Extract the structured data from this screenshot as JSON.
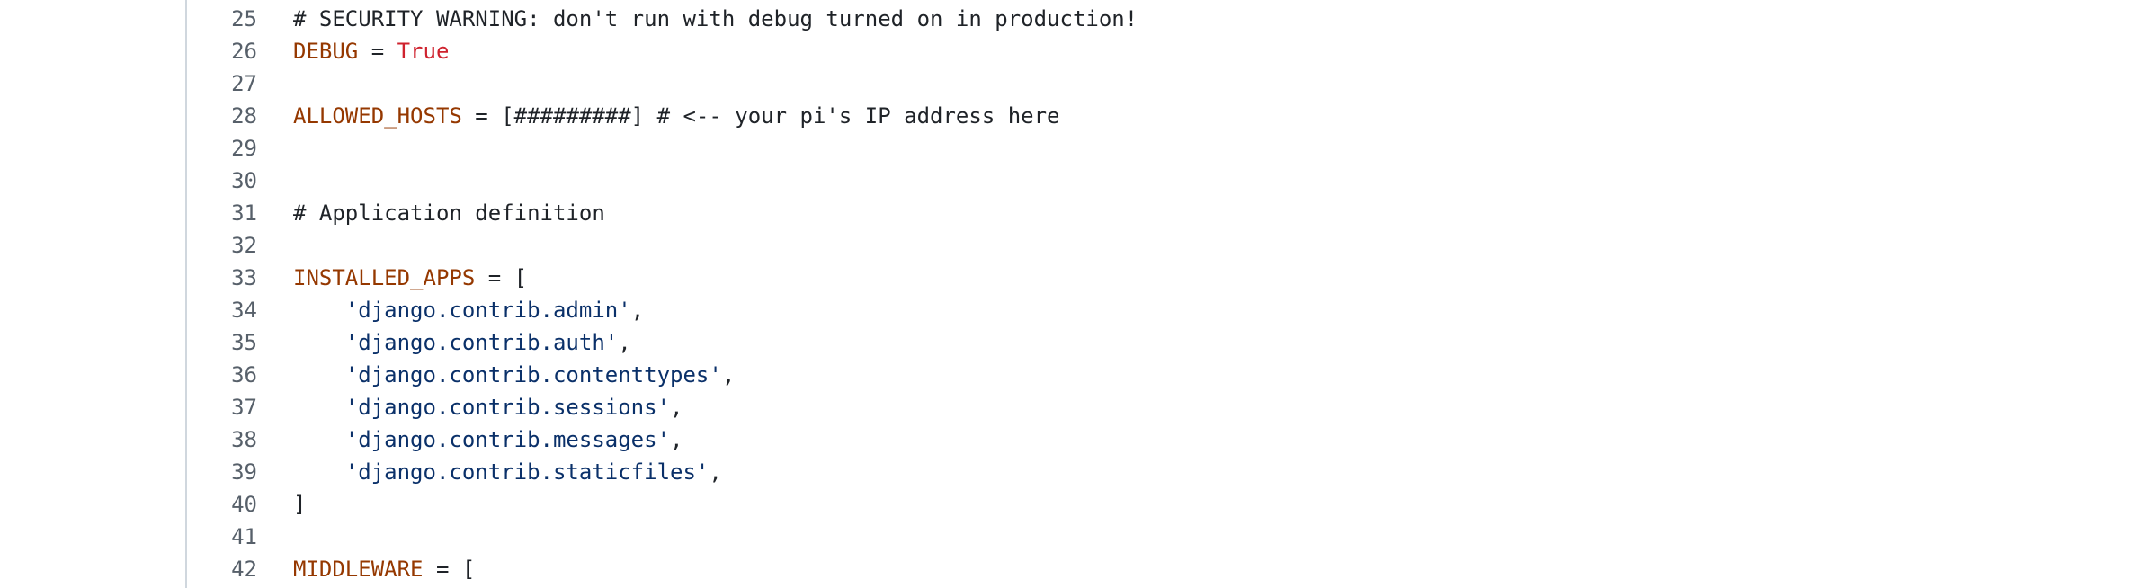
{
  "colors": {
    "variable": "#953800",
    "keyword": "#cf222e",
    "string": "#0a3069",
    "plain": "#1f2328",
    "line_number": "#57606a",
    "gutter_border": "#d0d7de"
  },
  "lines": [
    {
      "num": "25",
      "tokens": [
        {
          "t": "# SECURITY WARNING: don't run with debug turned on in production!",
          "c": "comment"
        }
      ]
    },
    {
      "num": "26",
      "tokens": [
        {
          "t": "DEBUG",
          "c": "var"
        },
        {
          "t": " = ",
          "c": "plain"
        },
        {
          "t": "True",
          "c": "kw"
        }
      ]
    },
    {
      "num": "27",
      "tokens": []
    },
    {
      "num": "28",
      "tokens": [
        {
          "t": "ALLOWED_HOSTS",
          "c": "var"
        },
        {
          "t": " = [#########] # <-- your pi's IP address here",
          "c": "plain"
        }
      ]
    },
    {
      "num": "29",
      "tokens": []
    },
    {
      "num": "30",
      "tokens": []
    },
    {
      "num": "31",
      "tokens": [
        {
          "t": "# Application definition",
          "c": "comment"
        }
      ]
    },
    {
      "num": "32",
      "tokens": []
    },
    {
      "num": "33",
      "tokens": [
        {
          "t": "INSTALLED_APPS",
          "c": "var"
        },
        {
          "t": " = [",
          "c": "plain"
        }
      ]
    },
    {
      "num": "34",
      "tokens": [
        {
          "t": "    ",
          "c": "plain"
        },
        {
          "t": "'django.contrib.admin'",
          "c": "str"
        },
        {
          "t": ",",
          "c": "plain"
        }
      ]
    },
    {
      "num": "35",
      "tokens": [
        {
          "t": "    ",
          "c": "plain"
        },
        {
          "t": "'django.contrib.auth'",
          "c": "str"
        },
        {
          "t": ",",
          "c": "plain"
        }
      ]
    },
    {
      "num": "36",
      "tokens": [
        {
          "t": "    ",
          "c": "plain"
        },
        {
          "t": "'django.contrib.contenttypes'",
          "c": "str"
        },
        {
          "t": ",",
          "c": "plain"
        }
      ]
    },
    {
      "num": "37",
      "tokens": [
        {
          "t": "    ",
          "c": "plain"
        },
        {
          "t": "'django.contrib.sessions'",
          "c": "str"
        },
        {
          "t": ",",
          "c": "plain"
        }
      ]
    },
    {
      "num": "38",
      "tokens": [
        {
          "t": "    ",
          "c": "plain"
        },
        {
          "t": "'django.contrib.messages'",
          "c": "str"
        },
        {
          "t": ",",
          "c": "plain"
        }
      ]
    },
    {
      "num": "39",
      "tokens": [
        {
          "t": "    ",
          "c": "plain"
        },
        {
          "t": "'django.contrib.staticfiles'",
          "c": "str"
        },
        {
          "t": ",",
          "c": "plain"
        }
      ]
    },
    {
      "num": "40",
      "tokens": [
        {
          "t": "]",
          "c": "plain"
        }
      ]
    },
    {
      "num": "41",
      "tokens": []
    },
    {
      "num": "42",
      "tokens": [
        {
          "t": "MIDDLEWARE",
          "c": "var"
        },
        {
          "t": " = [",
          "c": "plain"
        }
      ]
    }
  ]
}
